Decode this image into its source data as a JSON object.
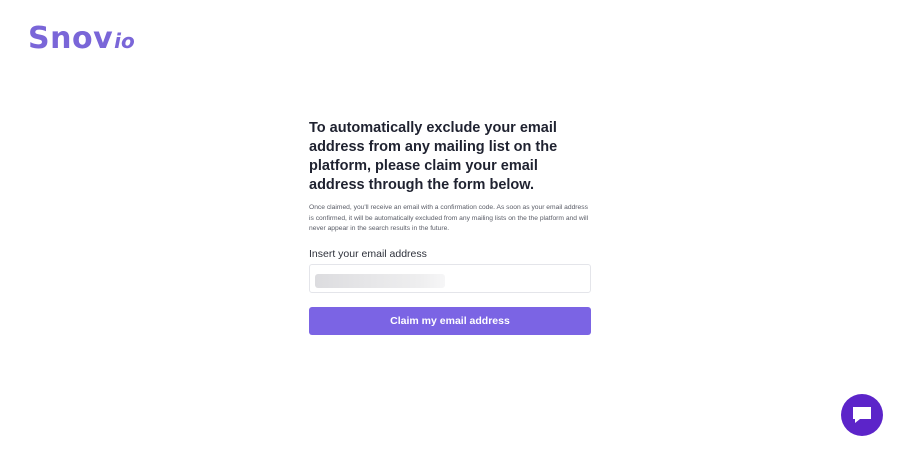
{
  "brand": {
    "logo_main": "Snov",
    "logo_sub": "io",
    "color": "#7a66d8"
  },
  "form": {
    "heading": "To automatically exclude your email address from any mailing list on the platform, please claim your email address through the form below.",
    "description": "Once claimed, you'll receive an email with a confirmation code. As soon as your email address is confirmed, it will be automatically excluded from any mailing lists on the the platform and will never appear in the search results in the future.",
    "email_label": "Insert your email address",
    "email_value": "",
    "submit_label": "Claim my email address",
    "button_color": "#7b64e4"
  },
  "chat_widget": {
    "icon": "chat-bubble-icon",
    "color": "#5c24c9"
  }
}
